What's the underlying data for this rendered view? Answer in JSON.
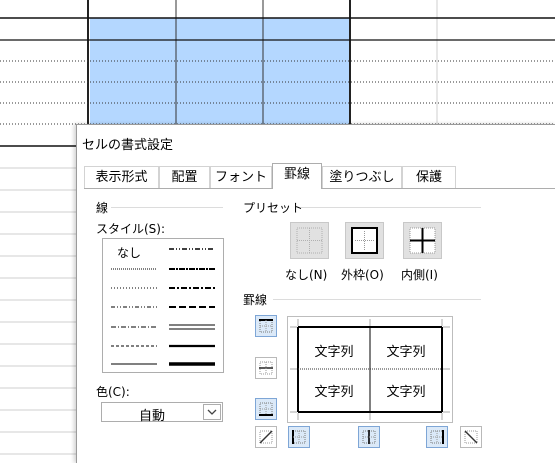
{
  "dialog": {
    "title": "セルの書式設定",
    "tabs": [
      {
        "label": "表示形式"
      },
      {
        "label": "配置"
      },
      {
        "label": "フォント"
      },
      {
        "label": "罫線",
        "active": true
      },
      {
        "label": "塗りつぶし"
      },
      {
        "label": "保護"
      }
    ]
  },
  "line_group": {
    "title": "線",
    "style_label": "スタイル(S):",
    "style_none": "なし",
    "color_label": "色(C):",
    "color_value": "自動"
  },
  "preset_group": {
    "title": "プリセット",
    "none": "なし(N)",
    "outline": "外枠(O)",
    "inside": "内側(I)"
  },
  "border_group": {
    "title": "罫線",
    "preview_text": [
      "文字列",
      "文字列",
      "文字列",
      "文字列"
    ]
  },
  "colors": {
    "selection": "#b4d7ff",
    "accent": "#dbe9f8"
  },
  "icons": [
    "dropdown-arrow-icon",
    "border-top-icon",
    "border-middle-horizontal-icon",
    "border-bottom-icon",
    "border-diagonal-up-icon",
    "border-left-icon",
    "border-middle-vertical-icon",
    "border-right-icon",
    "border-diagonal-down-icon"
  ]
}
